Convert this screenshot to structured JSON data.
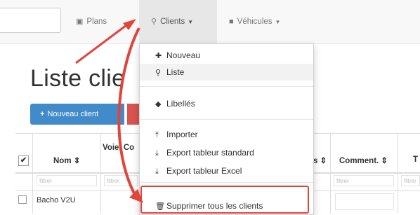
{
  "navbar": {
    "search": {
      "value": "",
      "placeholder": ""
    },
    "items": [
      {
        "label": "Plans",
        "icon": "calendar-icon",
        "has_caret": false
      },
      {
        "label": "Clients",
        "icon": "map-marker-icon",
        "has_caret": true
      },
      {
        "label": "Véhicules",
        "icon": "truck-icon",
        "has_caret": true
      }
    ]
  },
  "page": {
    "title": "Liste clie",
    "new_client_label": "Nouveau client"
  },
  "table": {
    "headers": [
      "Nom ⇕",
      "Voie, Co",
      "s ⇕",
      "Comment. ⇕",
      "T"
    ],
    "filter_placeholder": "filtrer",
    "rows": [
      {
        "name": "Bacho V2U"
      }
    ]
  },
  "dropdown": {
    "items": [
      {
        "label": "Nouveau",
        "icon": "plus-icon"
      },
      {
        "label": "Liste",
        "icon": "map-marker-icon"
      },
      {
        "label": "Libellés",
        "icon": "tags-icon"
      },
      {
        "label": "Importer",
        "icon": "upload-icon"
      },
      {
        "label": "Export tableur standard",
        "icon": "download-icon"
      },
      {
        "label": "Export tableur Excel",
        "icon": "download-icon"
      },
      {
        "label": "Supprimer tous les clients",
        "icon": "trash-icon"
      }
    ]
  },
  "colors": {
    "primary": "#428bca",
    "danger": "#d9534f",
    "annotation": "#e0453b"
  }
}
